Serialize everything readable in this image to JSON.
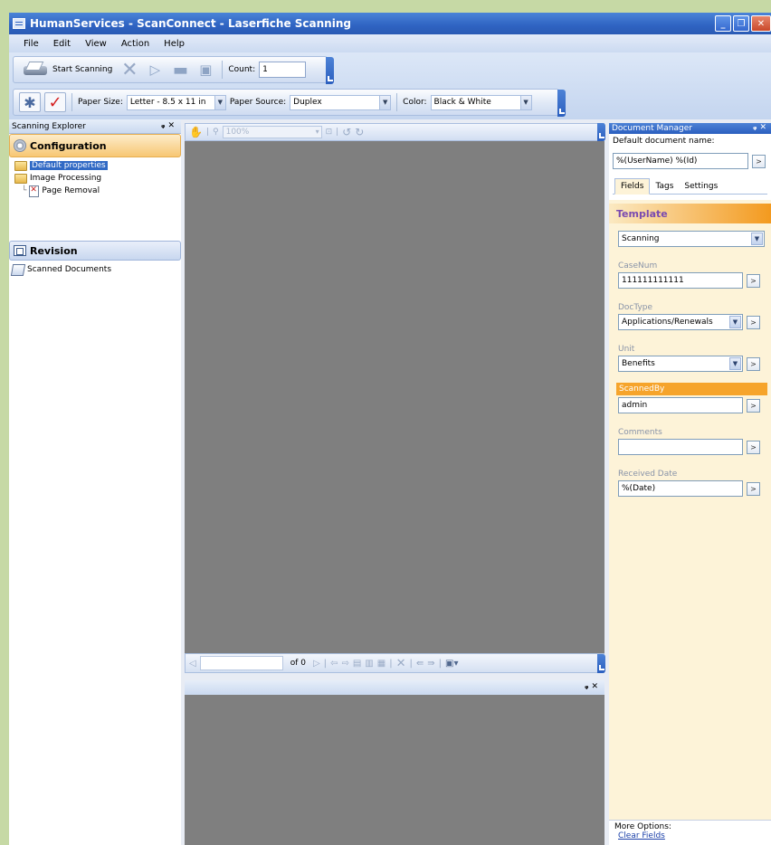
{
  "window": {
    "title": "HumanServices - ScanConnect - Laserfiche Scanning"
  },
  "menu": [
    "File",
    "Edit",
    "View",
    "Action",
    "Help"
  ],
  "toolbar1": {
    "start_scanning": "Start Scanning",
    "count_label": "Count:",
    "count_value": "1"
  },
  "toolbar2": {
    "paper_size_label": "Paper Size:",
    "paper_size_value": "Letter - 8.5 x 11 in",
    "paper_source_label": "Paper Source:",
    "paper_source_value": "Duplex",
    "color_label": "Color:",
    "color_value": "Black & White"
  },
  "scanning_explorer": {
    "title": "Scanning Explorer",
    "configuration": "Configuration",
    "tree": [
      "Default properties",
      "Image Processing",
      "Page Removal"
    ],
    "revision": "Revision",
    "revision_items": [
      "Scanned Documents"
    ]
  },
  "viewer": {
    "zoom": "100%",
    "page_of": "of 0"
  },
  "document_manager": {
    "title": "Document Manager",
    "default_name_label": "Default document name:",
    "default_name_value": "%(UserName) %(Id)",
    "tabs": [
      "Fields",
      "Tags",
      "Settings"
    ],
    "template_label": "Template",
    "template_value": "Scanning",
    "fields": {
      "casenum_label": "CaseNum",
      "casenum_value": "111111111111",
      "doctype_label": "DocType",
      "doctype_value": "Applications/Renewals",
      "unit_label": "Unit",
      "unit_value": "Benefits",
      "scannedby_label": "ScannedBy",
      "scannedby_value": "admin",
      "comments_label": "Comments",
      "comments_value": "",
      "received_label": "Received Date",
      "received_value": "%(Date)"
    },
    "more_options": "More Options:",
    "clear_fields": "Clear Fields"
  },
  "colors": {
    "title_blue": "#2f63c2",
    "config_orange": "#f7c774",
    "template_orange": "#f39a1f",
    "highlight_orange": "#f6a42b",
    "viewer_gray": "#7f7f7f",
    "panel_cream": "#fdf3d8"
  }
}
